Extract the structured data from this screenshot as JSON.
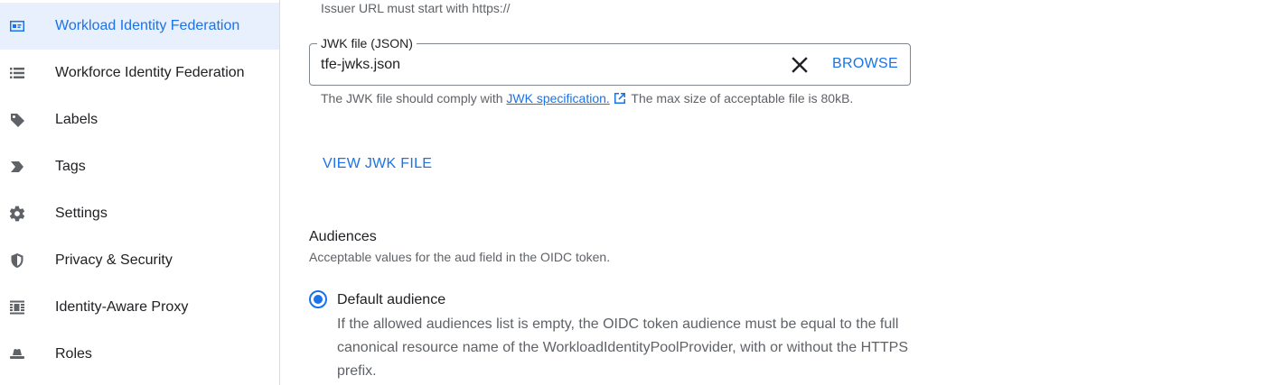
{
  "sidebar": {
    "items": [
      {
        "label": "Workload Identity Federation",
        "icon": "id-card-icon",
        "active": true
      },
      {
        "label": "Workforce Identity Federation",
        "icon": "list-icon",
        "active": false
      },
      {
        "label": "Labels",
        "icon": "label-tag-icon",
        "active": false
      },
      {
        "label": "Tags",
        "icon": "tag-chevron-icon",
        "active": false
      },
      {
        "label": "Settings",
        "icon": "gear-icon",
        "active": false
      },
      {
        "label": "Privacy & Security",
        "icon": "shield-icon",
        "active": false
      },
      {
        "label": "Identity-Aware Proxy",
        "icon": "proxy-icon",
        "active": false
      },
      {
        "label": "Roles",
        "icon": "hat-icon",
        "active": false
      }
    ]
  },
  "form": {
    "issuer_helper": "Issuer URL must start with https://",
    "jwk": {
      "label": "JWK file (JSON)",
      "value": "tfe-jwks.json",
      "browse_label": "BROWSE",
      "help_before": "The JWK file should comply with ",
      "help_link": "JWK specification.",
      "help_after": " The max size of acceptable file is 80kB.",
      "view_label": "VIEW JWK FILE"
    },
    "audiences": {
      "title": "Audiences",
      "description": "Acceptable values for the aud field in the OIDC token.",
      "option_label": "Default audience",
      "option_selected": true,
      "option_description": "If the allowed audiences list is empty, the OIDC token audience must be equal to the full canonical resource name of the WorkloadIdentityPoolProvider, with or without the HTTPS prefix."
    }
  },
  "colors": {
    "accent": "#1a73e8",
    "active_bg": "#e8f0fe",
    "text": "#202124",
    "muted": "#5f6368"
  }
}
